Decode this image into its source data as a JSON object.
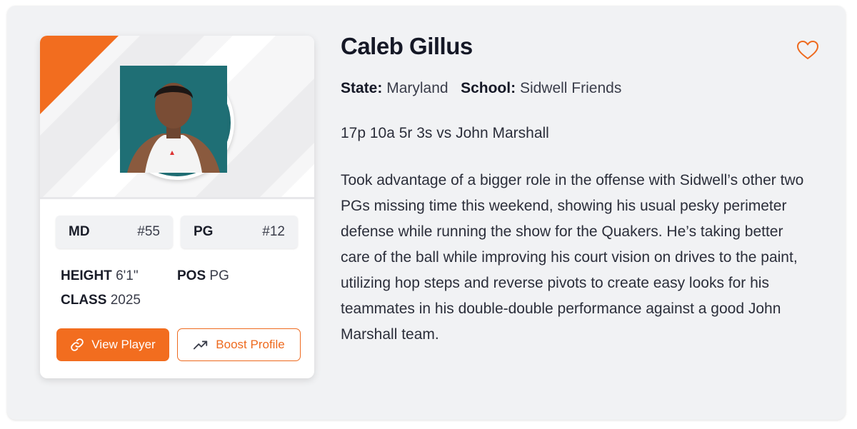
{
  "player": {
    "name": "Caleb Gillus",
    "state_label": "State:",
    "state": "Maryland",
    "school_label": "School:",
    "school": "Sidwell Friends",
    "statline": "17p 10a 5r 3s vs John Marshall",
    "description": "Took advantage of a bigger role in the offense with Sidwell’s other two PGs missing time this weekend, showing his usual pesky perimeter defense while running the show for the Quakers. He’s taking better care of the ball while improving his court vision on drives to the paint, utilizing hop steps and reverse pivots to create easy looks for his teammates in his double-double performance against a good John Marshall team."
  },
  "card": {
    "tags": [
      {
        "key": "MD",
        "value": "#55"
      },
      {
        "key": "PG",
        "value": "#12"
      }
    ],
    "stats": {
      "height_label": "HEIGHT",
      "height": "6'1\"",
      "pos_label": "POS",
      "pos": "PG",
      "class_label": "CLASS",
      "class": "2025"
    },
    "buttons": {
      "view_label": "View Player",
      "view_icon": "link-icon",
      "boost_label": "Boost Profile",
      "boost_icon": "trending-up-icon"
    }
  },
  "favorite_icon": "heart-icon",
  "colors": {
    "accent": "#f26d1f",
    "background": "#f1f2f4",
    "text": "#151826"
  }
}
